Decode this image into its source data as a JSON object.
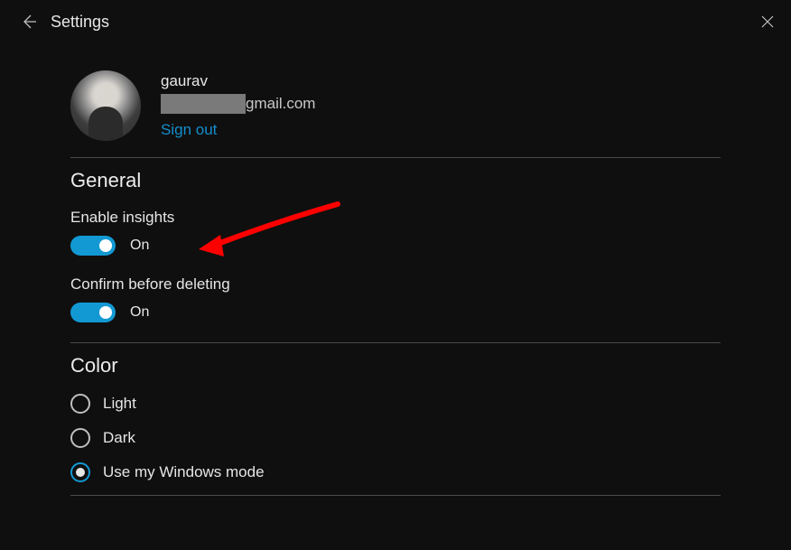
{
  "header": {
    "title": "Settings"
  },
  "profile": {
    "name": "gaurav",
    "email_suffix": "gmail.com",
    "signout_label": "Sign out"
  },
  "general": {
    "title": "General",
    "insights": {
      "label": "Enable insights",
      "state_label": "On",
      "on": true
    },
    "confirm_delete": {
      "label": "Confirm before deleting",
      "state_label": "On",
      "on": true
    }
  },
  "color": {
    "title": "Color",
    "options": [
      {
        "label": "Light",
        "selected": false
      },
      {
        "label": "Dark",
        "selected": false
      },
      {
        "label": "Use my Windows mode",
        "selected": true
      }
    ]
  },
  "colors": {
    "accent": "#1299d3",
    "link": "#148fcc",
    "bg": "#0f0f0f",
    "annotation": "#ff0000"
  }
}
